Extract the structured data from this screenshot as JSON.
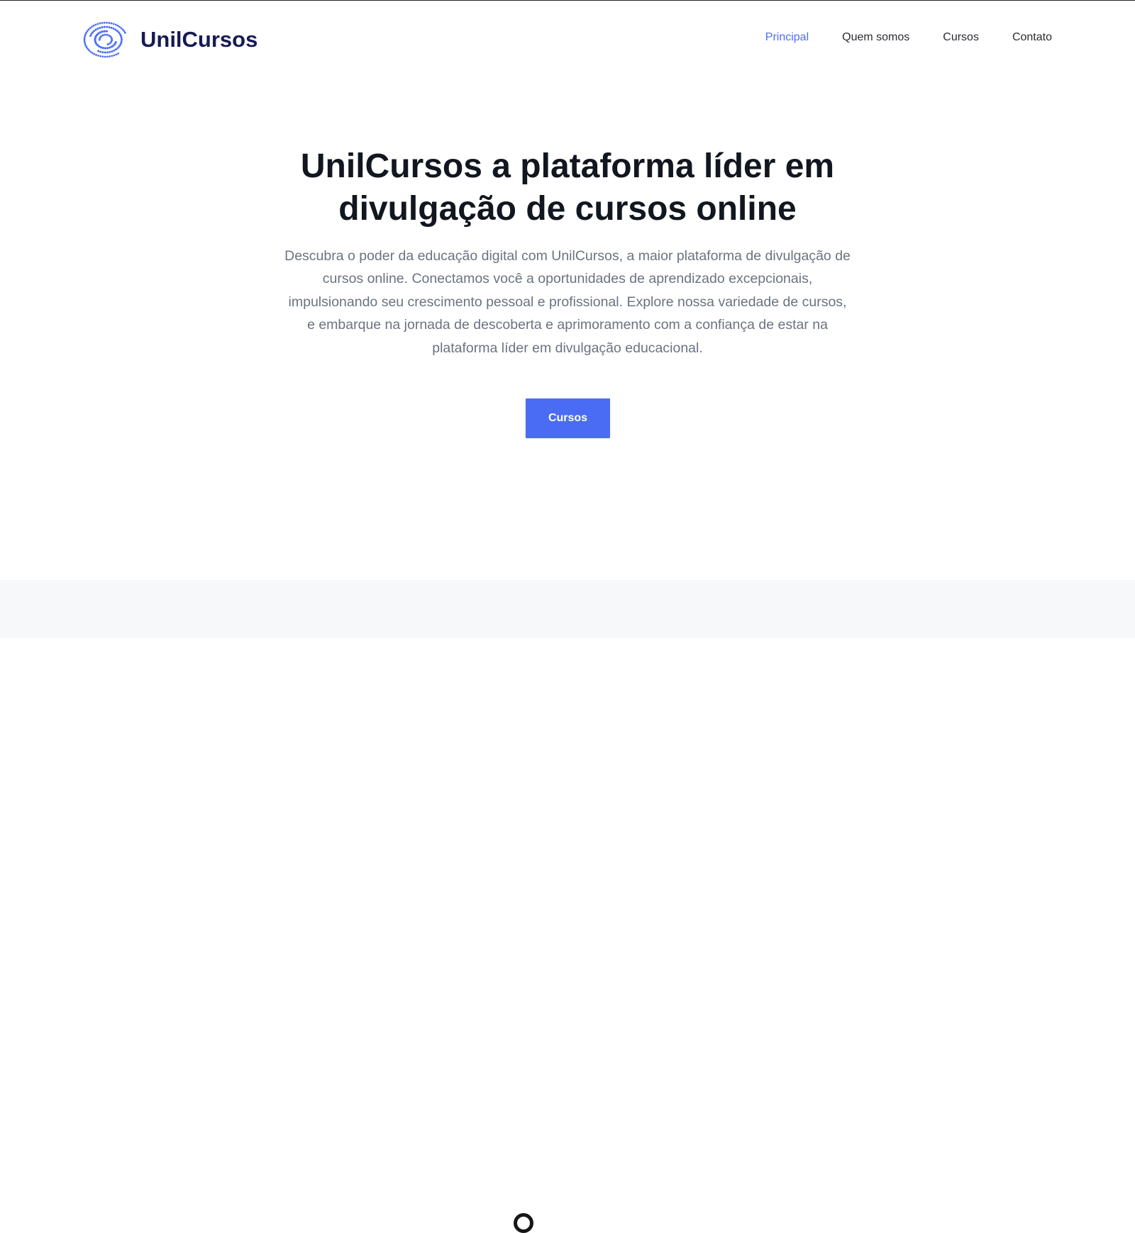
{
  "brand": {
    "name": "UnilCursos",
    "logo_icon": "spiral-dots-logo",
    "colors": {
      "name": "#161b54",
      "logo": "#4c6ef5"
    }
  },
  "nav": {
    "items": [
      {
        "label": "Principal",
        "active": true
      },
      {
        "label": "Quem somos",
        "active": false
      },
      {
        "label": "Cursos",
        "active": false
      },
      {
        "label": "Contato",
        "active": false
      }
    ]
  },
  "hero": {
    "title": "UnilCursos a plataforma líder em divulgação de cursos online",
    "description": "Descubra o poder da educação digital com UnilCursos, a maior plataforma de divulgação de cursos online. Conectamos você a oportunidades de aprendizado excepcionais, impulsionando seu crescimento pessoal e profissional. Explore nossa variedade de cursos, e embarque na jornada de descoberta e aprimoramento com a confiança de estar na plataforma líder em divulgação educacional.",
    "cta_label": "Cursos"
  },
  "colors": {
    "accent": "#4a6cf4",
    "title": "#12161f",
    "body_text": "#6b7380",
    "section_bg": "#f7f8f9"
  }
}
